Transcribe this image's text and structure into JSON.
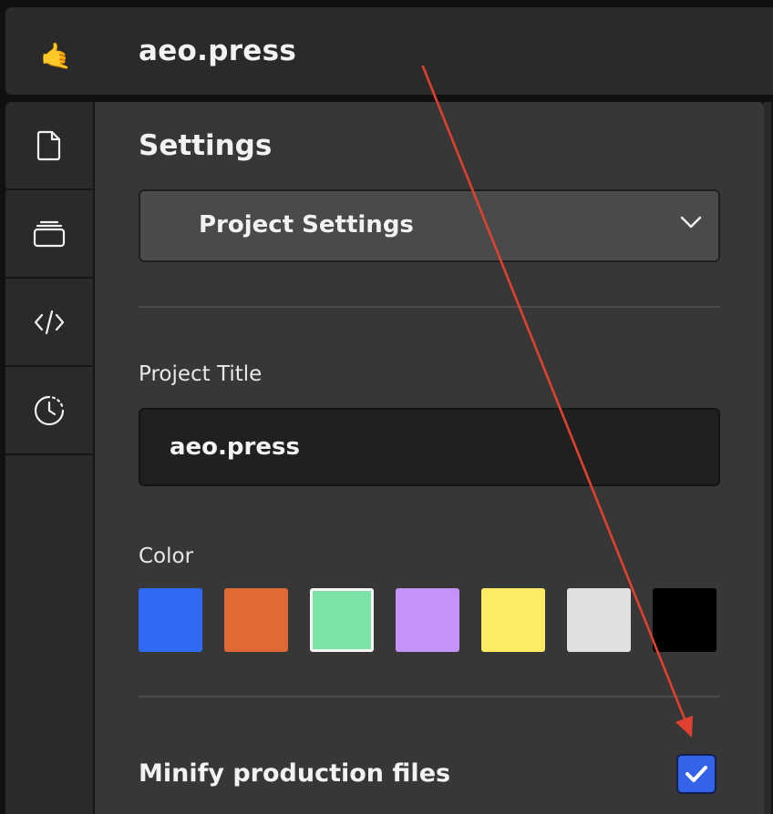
{
  "app": {
    "icon": "call-me-hand-icon",
    "title": "aeo.press"
  },
  "rail": {
    "items": [
      {
        "icon": "file-icon"
      },
      {
        "icon": "layers-icon"
      },
      {
        "icon": "code-icon"
      },
      {
        "icon": "history-clock-icon"
      }
    ]
  },
  "settings": {
    "title": "Settings",
    "section_select": {
      "value": "Project Settings",
      "icon": "chevron-down-icon"
    },
    "project_title": {
      "label": "Project Title",
      "value": "aeo.press"
    },
    "color": {
      "label": "Color",
      "swatches": [
        {
          "hex": "#2f6af2",
          "selected": false
        },
        {
          "hex": "#e06a36",
          "selected": false
        },
        {
          "hex": "#7be2a8",
          "selected": true
        },
        {
          "hex": "#c493f8",
          "selected": false
        },
        {
          "hex": "#fdec63",
          "selected": false
        },
        {
          "hex": "#e0e0e0",
          "selected": false
        },
        {
          "hex": "#000000",
          "selected": false
        }
      ]
    },
    "minify": {
      "label": "Minify production files",
      "checked": true,
      "icon": "checkmark-icon"
    }
  },
  "annotation": {
    "color": "#e0402f",
    "icon": "arrow-annotation"
  },
  "colors": {
    "panel": "#373737",
    "rail": "#2a2a2a",
    "accent": "#3462e8"
  }
}
